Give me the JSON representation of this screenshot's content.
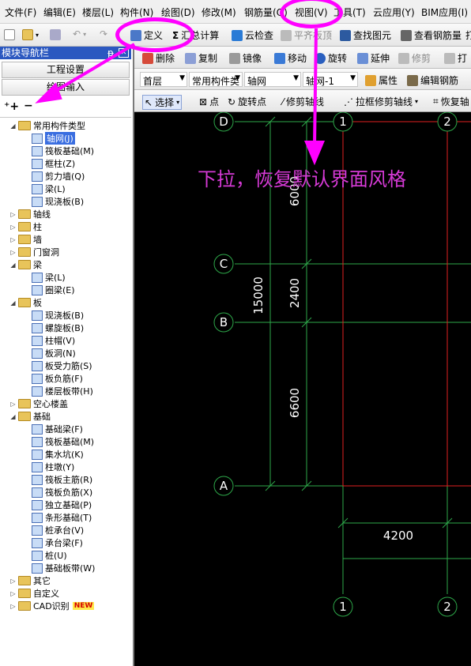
{
  "menu": [
    "文件(F)",
    "编辑(E)",
    "楼层(L)",
    "构件(N)",
    "绘图(D)",
    "修改(M)",
    "钢筋量(Q)",
    "视图(V)",
    "工具(T)",
    "云应用(Y)",
    "BIM应用(I)"
  ],
  "toolbar1": {
    "define": "定义",
    "sum": "汇总计算",
    "cloud_check": "云检查",
    "flat_slab": "平齐板顶",
    "find": "查找图元",
    "view_rebar": "查看钢筋量",
    "print": "打"
  },
  "toolbar2": {
    "delete": "删除",
    "copy": "复制",
    "mirror": "镜像",
    "move": "移动",
    "rotate": "旋转",
    "extend": "延伸",
    "trim": "修剪",
    "print2": "打"
  },
  "toolbar3": {
    "floor": "首层",
    "category": "常用构件类",
    "type": "轴网",
    "name": "轴网-1",
    "props": "属性",
    "edit_rebar": "编辑钢筋"
  },
  "toolbar4": {
    "select": "选择",
    "point": "点",
    "rotate_point": "旋转点",
    "trim_axis": "修剪轴线",
    "box_trim": "拉框修剪轴线",
    "restore": "恢复轴"
  },
  "panel": {
    "title": "模块导航栏",
    "pin": "ᵽ",
    "btn_project": "工程设置",
    "btn_draw": "绘图输入",
    "tree": [
      {
        "label": "常用构件类型",
        "type": "folder",
        "expanded": true,
        "level": 0
      },
      {
        "label": "轴网(J)",
        "type": "item",
        "level": 1,
        "selected": true
      },
      {
        "label": "筏板基础(M)",
        "type": "item",
        "level": 1
      },
      {
        "label": "框柱(Z)",
        "type": "item",
        "level": 1
      },
      {
        "label": "剪力墙(Q)",
        "type": "item",
        "level": 1
      },
      {
        "label": "梁(L)",
        "type": "item",
        "level": 1
      },
      {
        "label": "现浇板(B)",
        "type": "item",
        "level": 1
      },
      {
        "label": "轴线",
        "type": "folder",
        "expanded": false,
        "level": 0
      },
      {
        "label": "柱",
        "type": "folder",
        "expanded": false,
        "level": 0
      },
      {
        "label": "墙",
        "type": "folder",
        "expanded": false,
        "level": 0
      },
      {
        "label": "门窗洞",
        "type": "folder",
        "expanded": false,
        "level": 0
      },
      {
        "label": "梁",
        "type": "folder",
        "expanded": true,
        "level": 0
      },
      {
        "label": "梁(L)",
        "type": "item",
        "level": 1
      },
      {
        "label": "圈梁(E)",
        "type": "item",
        "level": 1
      },
      {
        "label": "板",
        "type": "folder",
        "expanded": true,
        "level": 0
      },
      {
        "label": "现浇板(B)",
        "type": "item",
        "level": 1
      },
      {
        "label": "螺旋板(B)",
        "type": "item",
        "level": 1
      },
      {
        "label": "柱帽(V)",
        "type": "item",
        "level": 1
      },
      {
        "label": "板洞(N)",
        "type": "item",
        "level": 1
      },
      {
        "label": "板受力筋(S)",
        "type": "item",
        "level": 1
      },
      {
        "label": "板负筋(F)",
        "type": "item",
        "level": 1
      },
      {
        "label": "楼层板带(H)",
        "type": "item",
        "level": 1
      },
      {
        "label": "空心楼盖",
        "type": "folder",
        "expanded": false,
        "level": 0
      },
      {
        "label": "基础",
        "type": "folder",
        "expanded": true,
        "level": 0
      },
      {
        "label": "基础梁(F)",
        "type": "item",
        "level": 1
      },
      {
        "label": "筏板基础(M)",
        "type": "item",
        "level": 1
      },
      {
        "label": "集水坑(K)",
        "type": "item",
        "level": 1
      },
      {
        "label": "柱墩(Y)",
        "type": "item",
        "level": 1
      },
      {
        "label": "筏板主筋(R)",
        "type": "item",
        "level": 1
      },
      {
        "label": "筏板负筋(X)",
        "type": "item",
        "level": 1
      },
      {
        "label": "独立基础(P)",
        "type": "item",
        "level": 1
      },
      {
        "label": "条形基础(T)",
        "type": "item",
        "level": 1
      },
      {
        "label": "桩承台(V)",
        "type": "item",
        "level": 1
      },
      {
        "label": "承台梁(F)",
        "type": "item",
        "level": 1
      },
      {
        "label": "桩(U)",
        "type": "item",
        "level": 1
      },
      {
        "label": "基础板带(W)",
        "type": "item",
        "level": 1
      },
      {
        "label": "其它",
        "type": "folder",
        "expanded": false,
        "level": 0
      },
      {
        "label": "自定义",
        "type": "folder",
        "expanded": false,
        "level": 0
      },
      {
        "label": "CAD识别",
        "type": "folder",
        "expanded": false,
        "level": 0,
        "badge": "NEW"
      }
    ]
  },
  "canvas": {
    "annotation": "下拉，恢复默认界面风格",
    "axis_labels": {
      "d": "D",
      "c": "C",
      "b": "B",
      "a": "A",
      "n1": "1",
      "n2": "2",
      "n1b": "1",
      "n2b": "2"
    },
    "dims": {
      "d6000": "6000",
      "d2400": "2400",
      "d6600": "6600",
      "d15000": "15000",
      "d4200": "4200"
    }
  },
  "colors": {
    "grid": "#2ea84a",
    "red": "#e02020",
    "magenta": "#ff00ff",
    "annotation": "#d63ad6"
  }
}
